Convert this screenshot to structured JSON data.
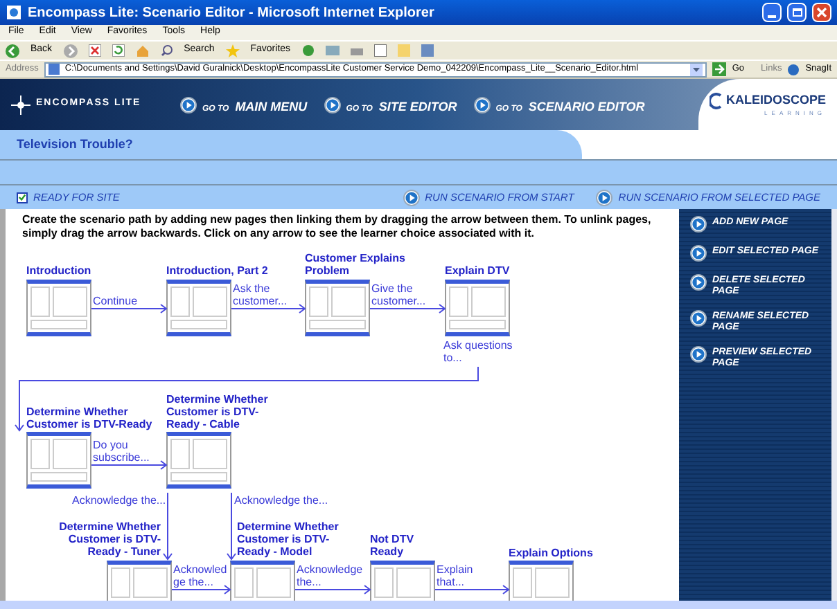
{
  "window": {
    "title": "Encompass Lite: Scenario Editor - Microsoft Internet Explorer"
  },
  "menu": [
    "File",
    "Edit",
    "View",
    "Favorites",
    "Tools",
    "Help"
  ],
  "toolbar": [
    "Back",
    "Search",
    "Favorites"
  ],
  "address": {
    "label": "Address",
    "url": "C:\\Documents and Settings\\David Guralnick\\Desktop\\EncompassLite Customer Service Demo_042209\\Encompass_Lite__Scenario_Editor.html",
    "go": "Go",
    "links": "Links",
    "snagit": "SnagIt"
  },
  "header": {
    "logo": "ENCOMPASS LITE",
    "nav": [
      {
        "prefix": "GO TO",
        "label": "MAIN MENU"
      },
      {
        "prefix": "GO TO",
        "label": "SITE EDITOR"
      },
      {
        "prefix": "GO TO",
        "label": "SCENARIO EDITOR"
      }
    ],
    "brand": "KALEIDOSCOPE",
    "brand_sub": "LEARNING"
  },
  "scenario_title": "Television Trouble?",
  "ready": {
    "label": "READY FOR SITE",
    "checked": true
  },
  "run_buttons": [
    "RUN SCENARIO FROM START",
    "RUN SCENARIO FROM SELECTED PAGE"
  ],
  "instructions": "Create the scenario path by adding new pages then linking them by dragging the arrow between them. To unlink pages, simply drag the arrow backwards. Click on any arrow to see the learner choice associated with it.",
  "sidebar": [
    "ADD NEW PAGE",
    "EDIT SELECTED PAGE",
    "DELETE SELECTED PAGE",
    "RENAME SELECTED PAGE",
    "PREVIEW SELECTED PAGE"
  ],
  "nodes": [
    {
      "title": "Introduction"
    },
    {
      "title": "Introduction, Part 2"
    },
    {
      "title": "Customer Explains Problem"
    },
    {
      "title": "Explain DTV"
    },
    {
      "title": "Determine Whether Customer is DTV-Ready"
    },
    {
      "title": "Determine Whether Customer is DTV-Ready - Cable"
    },
    {
      "title": "Determine Whether Customer is DTV-Ready - Tuner"
    },
    {
      "title": "Determine Whether Customer is DTV-Ready - Model"
    },
    {
      "title": "Not DTV Ready"
    },
    {
      "title": "Explain Options"
    }
  ],
  "links": [
    {
      "label": "Continue"
    },
    {
      "label": "Ask the customer..."
    },
    {
      "label": "Give the customer..."
    },
    {
      "label": "Ask questions to..."
    },
    {
      "label": "Do you subscribe..."
    },
    {
      "label": "Acknowledge the..."
    },
    {
      "label": "Acknowledge the..."
    },
    {
      "label": "Acknowledge the..."
    },
    {
      "label": "Acknowledge the..."
    },
    {
      "label": "Explain that..."
    }
  ]
}
